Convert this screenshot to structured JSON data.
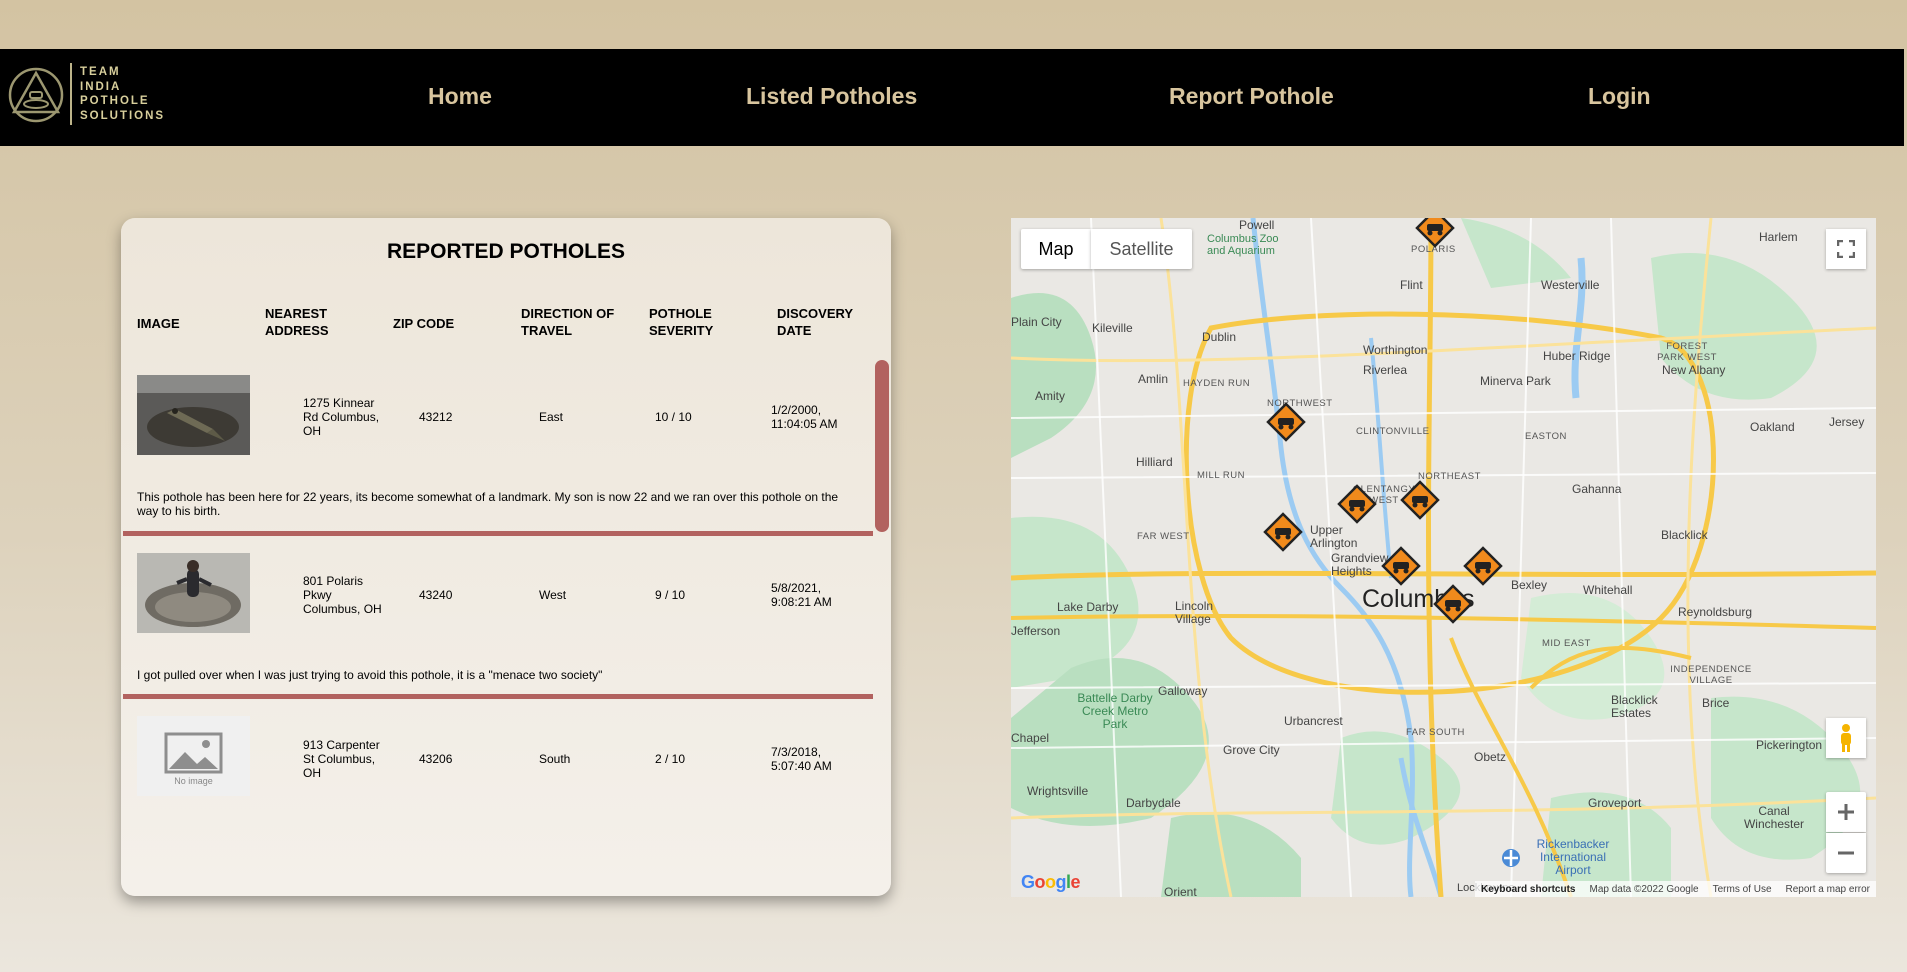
{
  "logo": {
    "lines": [
      "TEAM",
      "INDIA",
      "POTHOLE",
      "SOLUTIONS"
    ]
  },
  "nav": {
    "home": "Home",
    "listed": "Listed Potholes",
    "report": "Report Pothole",
    "login": "Login"
  },
  "table": {
    "title": "REPORTED POTHOLES",
    "headers": [
      "IMAGE",
      "NEAREST ADDRESS",
      "ZIP CODE",
      "DIRECTION OF TRAVEL",
      "POTHOLE SEVERITY",
      "DISCOVERY DATE"
    ],
    "rows": [
      {
        "image": "alligator-in-pothole",
        "address": "1275 Kinnear Rd Columbus, OH",
        "zip": "43212",
        "direction": "East",
        "severity": "10 / 10",
        "date": "1/2/2000, 11:04:05 AM",
        "description": "This pothole has been here for 22 years, its become somewhat of a landmark. My son is now 22 and we ran over this pothole on the way to his birth."
      },
      {
        "image": "person-in-flooded-pothole",
        "address": "801 Polaris Pkwy Columbus, OH",
        "zip": "43240",
        "direction": "West",
        "severity": "9 / 10",
        "date": "5/8/2021, 9:08:21 AM",
        "description": "I got pulled over when I was just trying to avoid this pothole, it is a \"menace two society\""
      },
      {
        "image": "placeholder",
        "image_label": "No image",
        "address": "913 Carpenter St Columbus, OH",
        "zip": "43206",
        "direction": "South",
        "severity": "2 / 10",
        "date": "7/3/2018, 5:07:40 AM",
        "description": ""
      }
    ]
  },
  "map": {
    "type_map": "Map",
    "type_satellite": "Satellite",
    "main_city": "Columbus",
    "cities": [
      "Powell",
      "Columbus Zoo and Aquarium",
      "Harlem",
      "Westerville",
      "Flint",
      "Plain City",
      "Kileville",
      "Dublin",
      "Worthington",
      "Huber Ridge",
      "New Albany",
      "Amlin",
      "Riverlea",
      "Minerva Park",
      "Amity",
      "Oakland",
      "Jersey",
      "Hilliard",
      "Gahanna",
      "Blacklick",
      "Upper Arlington",
      "Grandview Heights",
      "Bexley",
      "Whitehall",
      "Lake Darby",
      "Lincoln Village",
      "Reynoldsburg",
      "Jefferson",
      "Galloway",
      "Brice",
      "Battelle Darby Creek Metro Park",
      "Urbancrest",
      "Blacklick Estates",
      "Chapel",
      "Grove City",
      "Obetz",
      "Pickerington",
      "Wrightsville",
      "Darbydale",
      "Groveport",
      "Canal Winchester",
      "Rickenbacker International Airport",
      "Lockbourne",
      "Orient"
    ],
    "neighborhoods": [
      "POLARIS",
      "FOREST PARK WEST",
      "HAYDEN RUN",
      "NORTHWEST",
      "CLINTONVILLE",
      "EASTON",
      "MILL RUN",
      "NORTHEAST",
      "OLENTANGY WEST",
      "FAR WEST",
      "MID EAST",
      "INDEPENDENCE VILLAGE",
      "FAR SOUTH"
    ],
    "footer": {
      "shortcuts": "Keyboard shortcuts",
      "data": "Map data ©2022 Google",
      "terms": "Terms of Use",
      "error": "Report a map error"
    },
    "google": "Google",
    "colors": {
      "land": "#eae8e4",
      "park": "#b9dfc0",
      "water": "#9ccbf2",
      "road": "#f7c948",
      "marker": "#f08a1c"
    }
  }
}
